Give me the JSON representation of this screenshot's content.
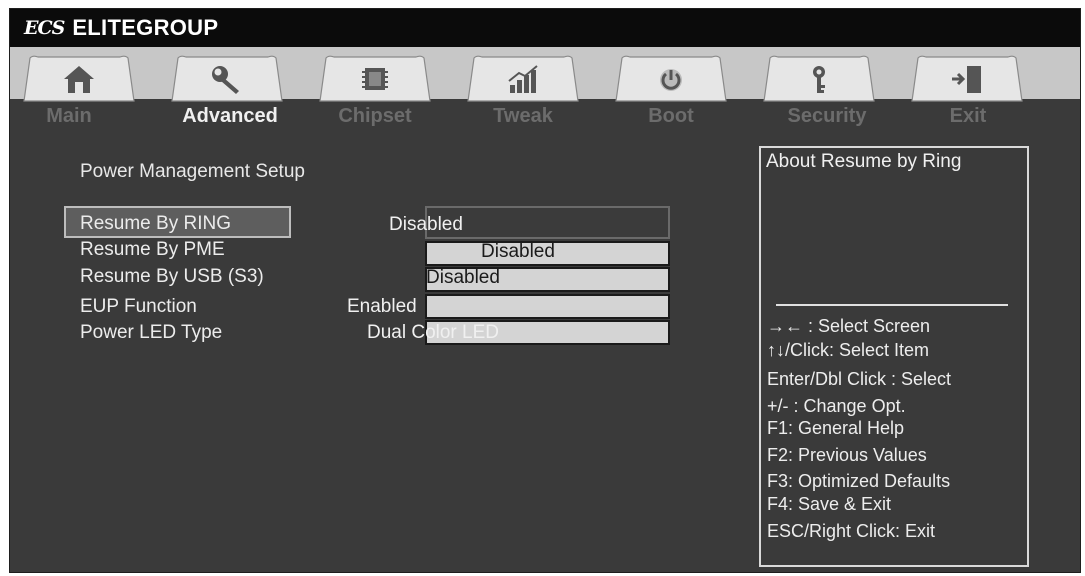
{
  "brand": {
    "logo": "ECS",
    "name": "ELITEGROUP"
  },
  "tabs": [
    {
      "label": "Main",
      "icon": "home-icon"
    },
    {
      "label": "Advanced",
      "icon": "wrench-icon",
      "active": true
    },
    {
      "label": "Chipset",
      "icon": "chip-icon"
    },
    {
      "label": "Tweak",
      "icon": "bar-chart-icon"
    },
    {
      "label": "Boot",
      "icon": "power-icon"
    },
    {
      "label": "Security",
      "icon": "key-icon"
    },
    {
      "label": "Exit",
      "icon": "exit-door-icon"
    }
  ],
  "main": {
    "section_title": "Power Management Setup",
    "settings": [
      {
        "label": "Resume By RING",
        "value": "Disabled",
        "selected": true
      },
      {
        "label": "Resume By PME",
        "value": "Disabled"
      },
      {
        "label": "Resume By USB (S3)",
        "value": "Disabled"
      },
      {
        "label": "EUP Function",
        "value": "Enabled"
      },
      {
        "label": "Power LED Type",
        "value": "Dual Color LED"
      }
    ]
  },
  "help": {
    "title": "About  Resume by Ring",
    "hotkeys": [
      "→←   : Select Screen",
      "↑↓/Click: Select Item",
      "Enter/Dbl Click : Select",
      "+/- : Change Opt.",
      "F1: General Help",
      "F2: Previous Values",
      "F3: Optimized Defaults",
      "F4: Save & Exit",
      "ESC/Right Click: Exit"
    ]
  },
  "colors": {
    "background": "#3a3a3a",
    "tab_band": "#c7c7c7",
    "active_tab_label": "#f0f0f0",
    "inactive_tab_label": "#6c6c6c"
  }
}
